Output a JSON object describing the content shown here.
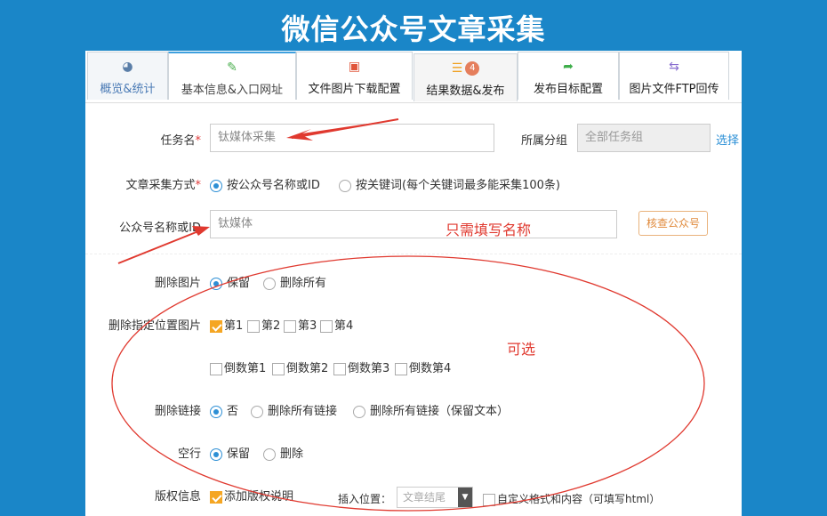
{
  "page_title": "微信公众号文章采集",
  "tabs": [
    {
      "label": "概览&统计",
      "icon": "dashboard-icon"
    },
    {
      "label": "基本信息&入口网址",
      "icon": "edit-icon"
    },
    {
      "label": "文件图片下载配置",
      "icon": "image-icon"
    },
    {
      "label": "结果数据&发布",
      "icon": "database-icon",
      "badge": "4"
    },
    {
      "label": "发布目标配置",
      "icon": "share-icon"
    },
    {
      "label": "图片文件FTP回传",
      "icon": "transfer-icon"
    }
  ],
  "form": {
    "task_name_label": "任务名",
    "task_name_value": "钛媒体采集",
    "group_label": "所属分组",
    "group_value": "全部任务组",
    "group_select_link": "选择",
    "method_label": "文章采集方式",
    "method_option_1": "按公众号名称或ID",
    "method_option_2": "按关键词(每个关键词最多能采集100条)",
    "account_label": "公众号名称或ID",
    "account_value": "钛媒体",
    "check_account_button": "核查公众号",
    "delete_images_label": "删除图片",
    "delete_images_keep": "保留",
    "delete_images_all": "删除所有",
    "delete_pos_images_label": "删除指定位置图片",
    "pos_checkboxes": [
      "第1",
      "第2",
      "第3",
      "第4"
    ],
    "pos_checkboxes_rev": [
      "倒数第1",
      "倒数第2",
      "倒数第3",
      "倒数第4"
    ],
    "delete_links_label": "删除链接",
    "delete_links_no": "否",
    "delete_links_all": "删除所有链接",
    "delete_links_keep_text": "删除所有链接（保留文本）",
    "blank_lines_label": "空行",
    "blank_lines_keep": "保留",
    "blank_lines_delete": "删除",
    "copyright_label": "版权信息",
    "copyright_add": "添加版权说明",
    "insert_pos_label": "插入位置：",
    "insert_pos_value": "文章结尾",
    "custom_format": "自定义格式和内容（可填写html）"
  },
  "annotations": {
    "only_name": "只需填写名称",
    "optional": "可选"
  },
  "colors": {
    "background": "#1a86c8",
    "annotation": "#e0392f",
    "accent": "#2d8fd5",
    "checkbox": "#f5a623"
  }
}
